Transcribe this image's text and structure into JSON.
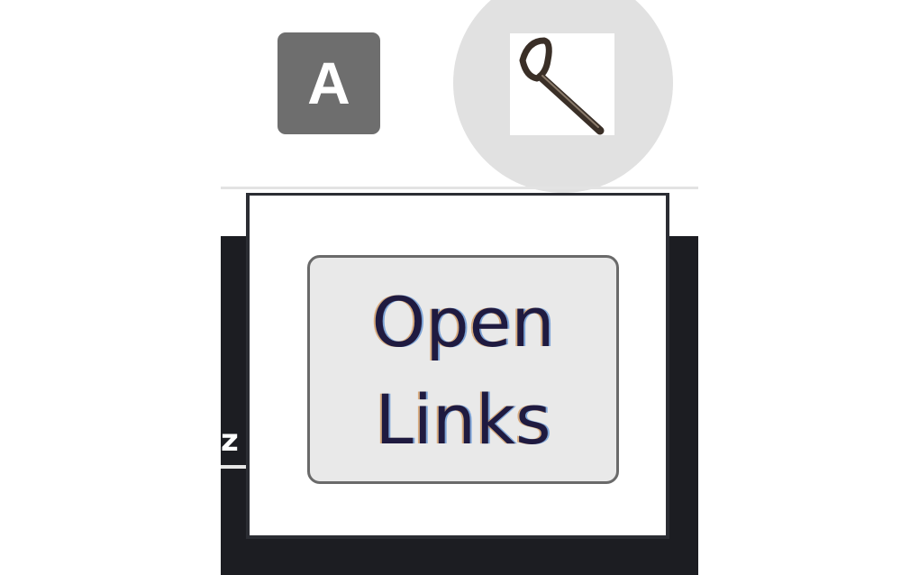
{
  "toolbar": {
    "extension_a": {
      "label": "A",
      "icon": "letter-a-icon",
      "background": "#6e6e6e"
    },
    "extension_active": {
      "icon": "magnifier-icon",
      "highlight": "#e1e1e1"
    }
  },
  "page": {
    "fragment_text": "z",
    "background": "#1c1d22"
  },
  "popup": {
    "button": {
      "line1": "Open",
      "line2": "Links"
    }
  }
}
